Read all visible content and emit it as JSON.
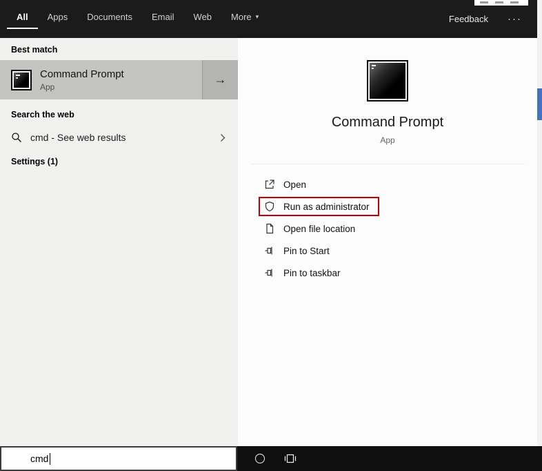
{
  "colors": {
    "highlight": "#c00000",
    "topbar_bg": "#1b1b1b",
    "left_panel_bg": "#f1f1f0",
    "selection_bg": "#c4c4c2",
    "taskbar_bg": "#0f0f0f",
    "background_accent": "#4472c4"
  },
  "header": {
    "tabs": [
      {
        "label": "All",
        "active": true
      },
      {
        "label": "Apps",
        "active": false
      },
      {
        "label": "Documents",
        "active": false
      },
      {
        "label": "Email",
        "active": false
      },
      {
        "label": "Web",
        "active": false
      },
      {
        "label": "More",
        "active": false,
        "has_dropdown": true
      }
    ],
    "more_arrow": "▾",
    "feedback": "Feedback",
    "overflow": "···"
  },
  "left_panel": {
    "best_match_header": "Best match",
    "best_match": {
      "title": "Command Prompt",
      "subtitle": "App",
      "arrow": "→"
    },
    "search_web_header": "Search the web",
    "web_suggestion": {
      "query": "cmd",
      "hint": " - See web results"
    },
    "settings_header": "Settings (1)"
  },
  "right_panel": {
    "app_title": "Command Prompt",
    "app_subtitle": "App",
    "actions": [
      {
        "label": "Open",
        "icon": "open-icon",
        "highlighted": false
      },
      {
        "label": "Run as administrator",
        "icon": "shield-icon",
        "highlighted": true
      },
      {
        "label": "Open file location",
        "icon": "file-location-icon",
        "highlighted": false
      },
      {
        "label": "Pin to Start",
        "icon": "pin-icon",
        "highlighted": false
      },
      {
        "label": "Pin to taskbar",
        "icon": "pin-icon",
        "highlighted": false
      }
    ]
  },
  "taskbar": {
    "search_value": "cmd"
  }
}
